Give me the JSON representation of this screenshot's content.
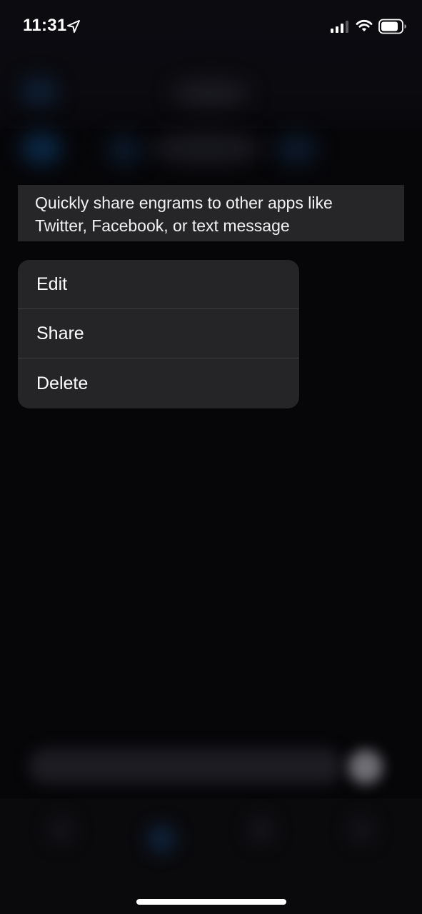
{
  "status_bar": {
    "time": "11:31",
    "location_icon": "location-arrow-icon",
    "signal_icon": "cellular-signal-icon",
    "wifi_icon": "wifi-icon",
    "battery_icon": "battery-icon"
  },
  "tooltip": {
    "text": "Quickly share engrams to other apps like Twitter, Facebook, or text message"
  },
  "context_menu": {
    "items": [
      {
        "label": "Edit"
      },
      {
        "label": "Share"
      },
      {
        "label": "Delete"
      }
    ]
  },
  "colors": {
    "background": "#060609",
    "menu_background": "#252528",
    "tooltip_background": "#262629",
    "separator": "#3c3c41",
    "text": "#ffffff"
  }
}
